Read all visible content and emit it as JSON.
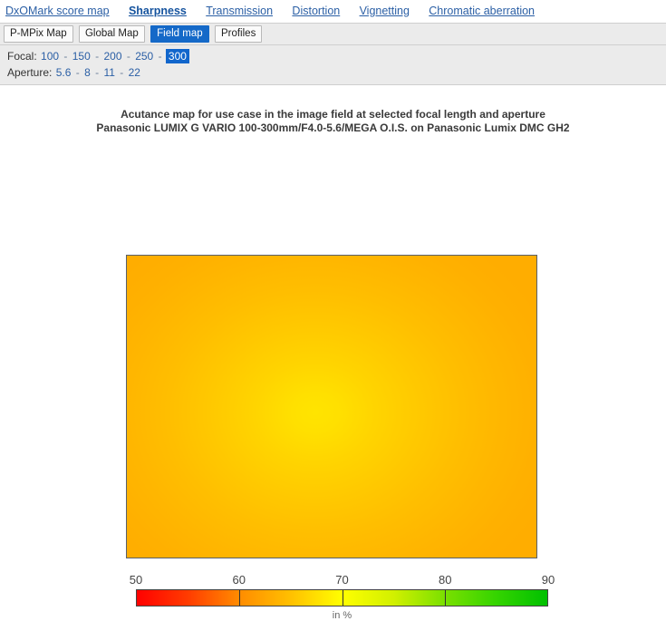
{
  "topnav": {
    "items": [
      {
        "label": "DxOMark score map",
        "active": false
      },
      {
        "label": "Sharpness",
        "active": true
      },
      {
        "label": "Transmission",
        "active": false
      },
      {
        "label": "Distortion",
        "active": false
      },
      {
        "label": "Vignetting",
        "active": false
      },
      {
        "label": "Chromatic aberration",
        "active": false
      }
    ]
  },
  "subtabs": {
    "items": [
      {
        "label": "P-MPix Map",
        "active": false
      },
      {
        "label": "Global Map",
        "active": false
      },
      {
        "label": "Field map",
        "active": true
      },
      {
        "label": "Profiles",
        "active": false
      }
    ]
  },
  "filters": {
    "focal": {
      "label": "Focal:",
      "options": [
        "100",
        "150",
        "200",
        "250",
        "300"
      ],
      "selected": "300"
    },
    "aperture": {
      "label": "Aperture:",
      "options": [
        "5.6",
        "8",
        "11",
        "22"
      ],
      "selected": null
    },
    "separator": "-"
  },
  "chart_data": {
    "type": "heatmap",
    "title": "Acutance map for use case in the image field at selected focal length and aperture",
    "subtitle": "Panasonic LUMIX G VARIO 100-300mm/F4.0-5.6/MEGA O.I.S. on Panasonic Lumix DMC GH2",
    "xlabel": "",
    "ylabel": "",
    "colorbar": {
      "label": "in %",
      "min": 50,
      "max": 90,
      "ticks": [
        50,
        60,
        70,
        80,
        90
      ],
      "stops": [
        {
          "value": 50,
          "color": "#ff0000"
        },
        {
          "value": 60,
          "color": "#ff8c00"
        },
        {
          "value": 70,
          "color": "#ffff00"
        },
        {
          "value": 80,
          "color": "#7ae000"
        },
        {
          "value": 90,
          "color": "#00c000"
        }
      ]
    },
    "field": {
      "description": "Radial acutance falloff: bright yellow hotspot slightly right of and below center, fading smoothly to orange toward the frame edges and corners.",
      "center": {
        "x_frac": 0.46,
        "y_frac": 0.52
      },
      "center_value": 70,
      "edge_value": 64,
      "corner_value": 63,
      "grid_x_fracs": [
        0.0,
        0.25,
        0.5,
        0.75,
        1.0
      ],
      "grid_y_fracs": [
        0.0,
        0.25,
        0.5,
        0.75,
        1.0
      ],
      "values": [
        [
          63,
          64,
          64,
          64,
          63
        ],
        [
          64,
          66,
          67,
          66,
          64
        ],
        [
          64,
          68,
          70,
          68,
          65
        ],
        [
          64,
          67,
          68,
          67,
          65
        ],
        [
          64,
          65,
          65,
          65,
          64
        ]
      ]
    }
  }
}
